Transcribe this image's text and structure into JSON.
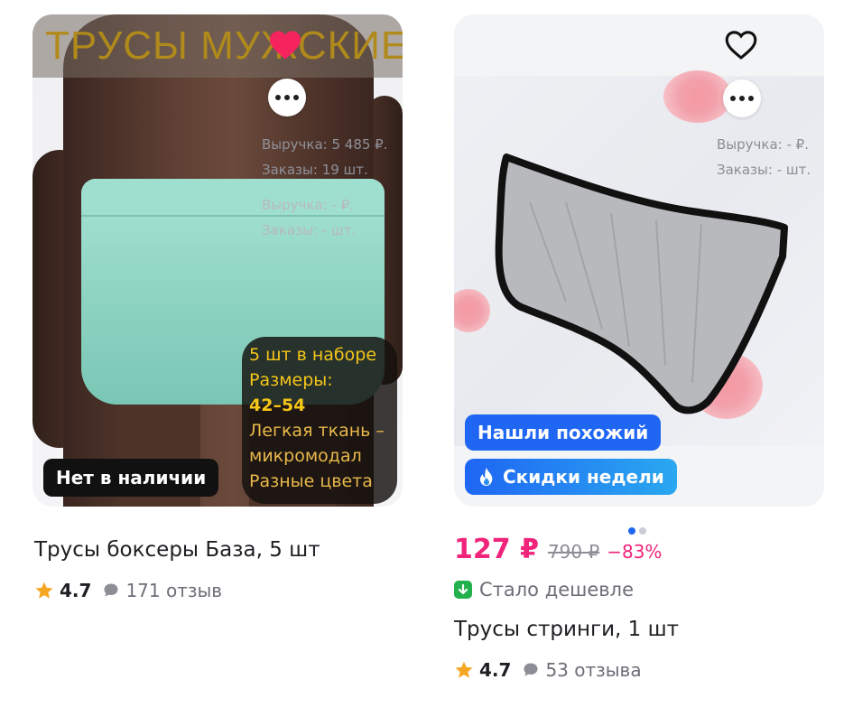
{
  "products": [
    {
      "banner": "ТРУСЫ МУЖСКИЕ",
      "stats_primary": {
        "revenue": "Выручка: 5 485 ₽.",
        "orders": "Заказы: 19 шт."
      },
      "stats_secondary": {
        "revenue": "Выручка: - ₽.",
        "orders": "Заказы: - шт."
      },
      "info_panel": {
        "line1": "5 шт в наборе",
        "line2": "Размеры:",
        "line3": "42–54",
        "line4": "Легкая ткань –",
        "line5": "микромодал",
        "line6": "Разные цвета"
      },
      "stock_badge": "Нет в наличии",
      "title": "Трусы боксеры База, 5 шт",
      "rating": "4.7",
      "reviews": "171 отзыв",
      "favorite_active": true
    },
    {
      "stats_primary": {
        "revenue": "Выручка: - ₽.",
        "orders": "Заказы: - шт."
      },
      "tag_similar": "Нашли похожий",
      "tag_sale": "Скидки недели",
      "price": "127 ₽",
      "old_price": "790 ₽",
      "discount": "−83%",
      "cheaper_label": "Стало дешевле",
      "title": "Трусы стринги, 1 шт",
      "rating": "4.7",
      "reviews": "53 отзыва",
      "favorite_active": false,
      "gallery": {
        "total": 2,
        "active": 1
      }
    }
  ],
  "icons": {
    "favorite": "heart-icon",
    "more": "more-dots-icon",
    "star": "star-icon",
    "review": "chat-bubble-icon",
    "fire": "fire-icon",
    "price_down": "arrow-down-icon"
  },
  "colors": {
    "accent_pink": "#f0247a",
    "heart_active": "#f5235e",
    "star": "#f5a623",
    "chip_blue": "#1f66f3",
    "cheaper_green": "#22b14c"
  }
}
